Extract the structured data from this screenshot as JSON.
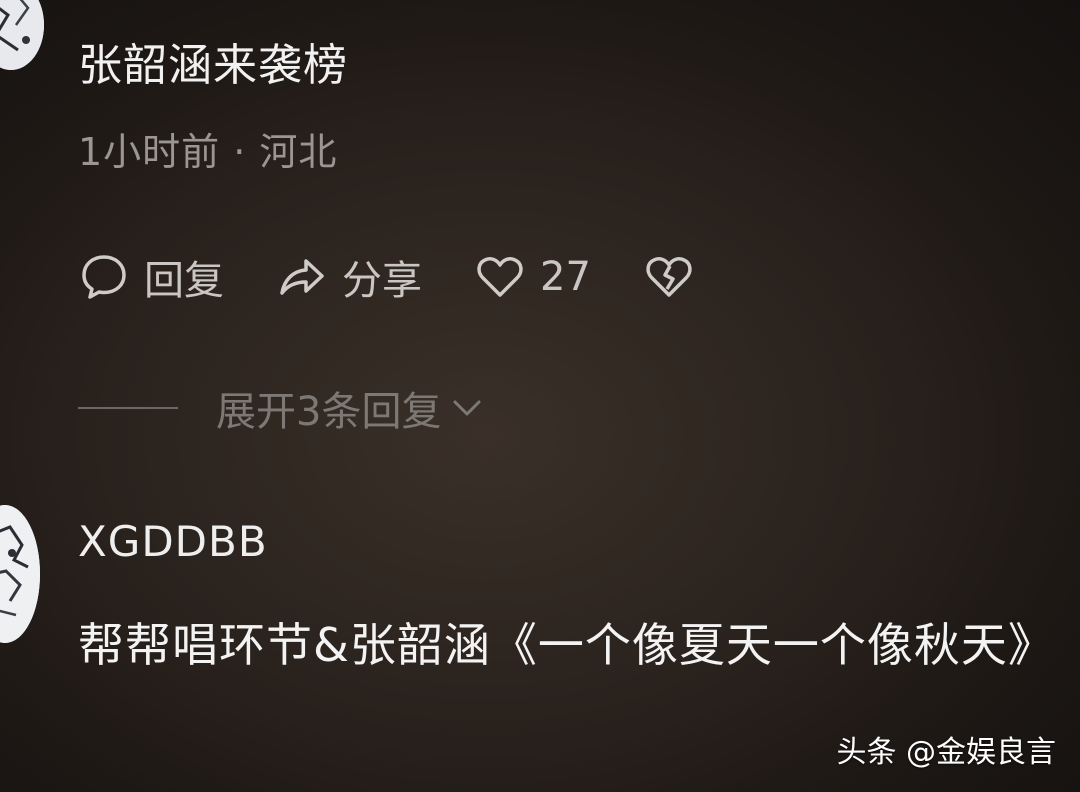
{
  "comment1": {
    "username": "张韶涵来袭榜",
    "meta": "1小时前 · 河北",
    "actions": {
      "reply_label": "回复",
      "share_label": "分享",
      "like_count": "27"
    },
    "expand_replies": "展开3条回复"
  },
  "comment2": {
    "username": "XGDDBB",
    "text": "帮帮唱环节&张韶涵《一个像夏天一个像秋天》",
    "next_line_partial": "— · · — · — —"
  },
  "watermark": "头条 @金娱良言",
  "icons": {
    "reply": "speech-bubble-icon",
    "share": "share-arrow-icon",
    "like": "heart-icon",
    "dislike": "broken-heart-icon",
    "expand": "chevron-down-icon"
  }
}
